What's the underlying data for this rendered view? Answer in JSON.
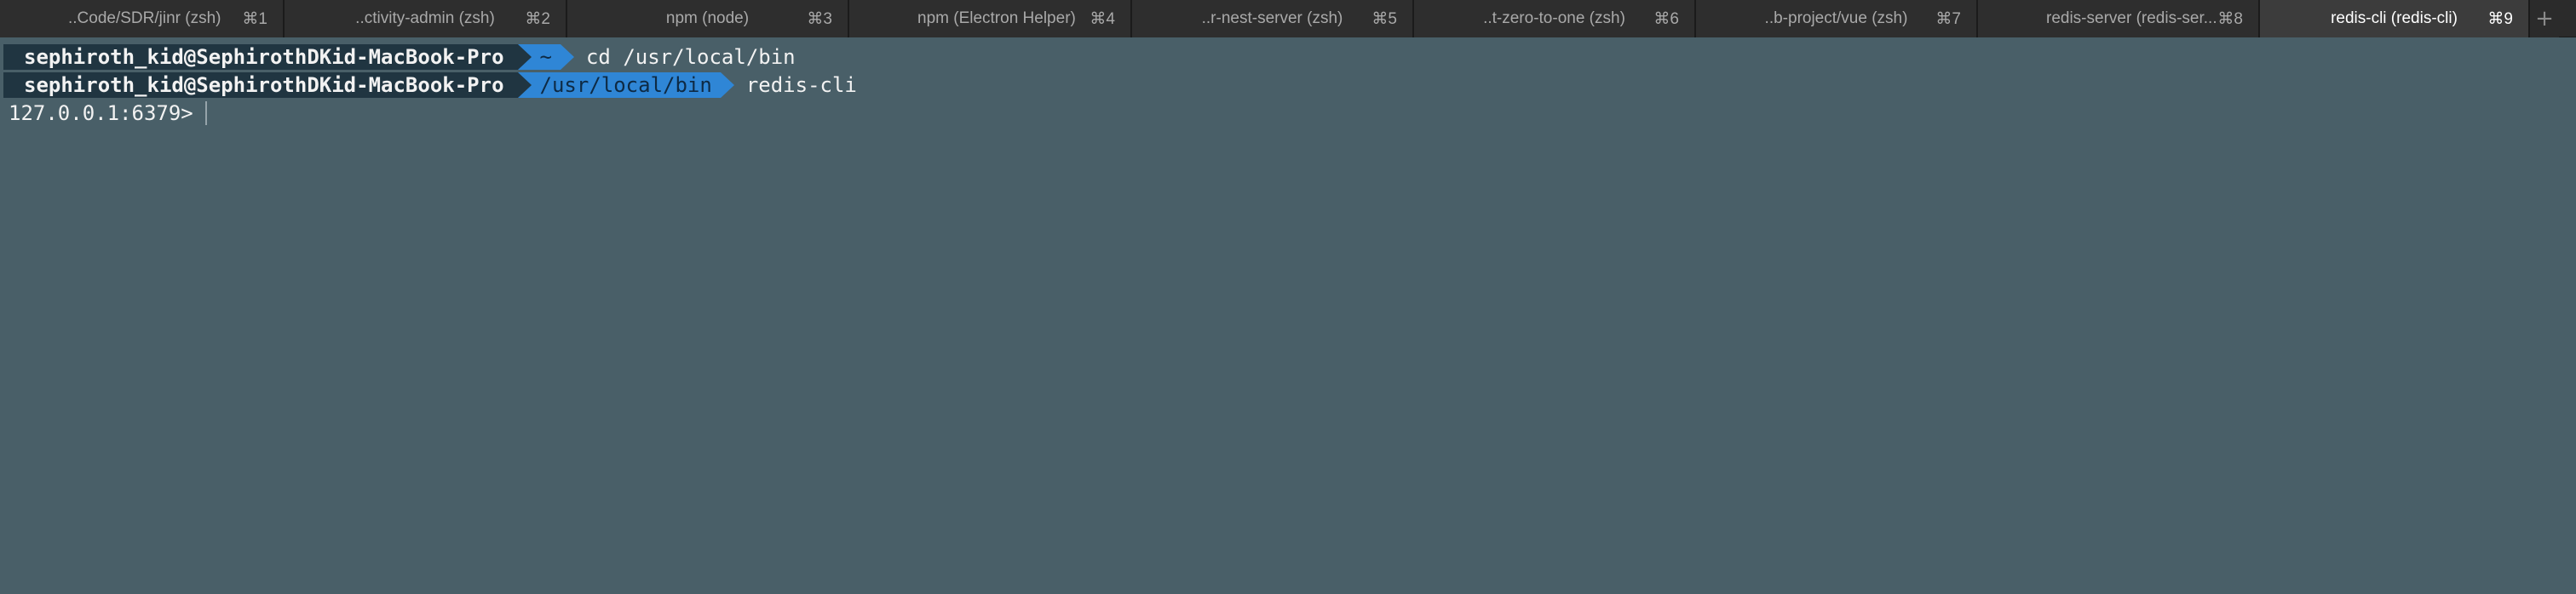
{
  "tabs": [
    {
      "title": "..Code/SDR/jinr (zsh)",
      "shortcut": "⌘1",
      "active": false
    },
    {
      "title": "..ctivity-admin (zsh)",
      "shortcut": "⌘2",
      "active": false
    },
    {
      "title": "npm (node)",
      "shortcut": "⌘3",
      "active": false
    },
    {
      "title": "npm (Electron Helper)",
      "shortcut": "⌘4",
      "active": false
    },
    {
      "title": "..r-nest-server (zsh)",
      "shortcut": "⌘5",
      "active": false
    },
    {
      "title": "..t-zero-to-one (zsh)",
      "shortcut": "⌘6",
      "active": false
    },
    {
      "title": "..b-project/vue (zsh)",
      "shortcut": "⌘7",
      "active": false
    },
    {
      "title": "redis-server (redis-ser...",
      "shortcut": "⌘8",
      "active": false
    },
    {
      "title": "redis-cli (redis-cli)",
      "shortcut": "⌘9",
      "active": true
    }
  ],
  "new_tab_label": "+",
  "terminal": {
    "lines": [
      {
        "user": "sephiroth_kid@SephirothDKid-MacBook-Pro",
        "dir": "~",
        "cmd": "cd /usr/local/bin"
      },
      {
        "user": "sephiroth_kid@SephirothDKid-MacBook-Pro",
        "dir": "/usr/local/bin",
        "cmd": "redis-cli"
      }
    ],
    "prompt": "127.0.0.1:6379>"
  },
  "colors": {
    "background": "#495f68",
    "user_segment": "#203541",
    "dir_segment": "#2f86d6"
  }
}
